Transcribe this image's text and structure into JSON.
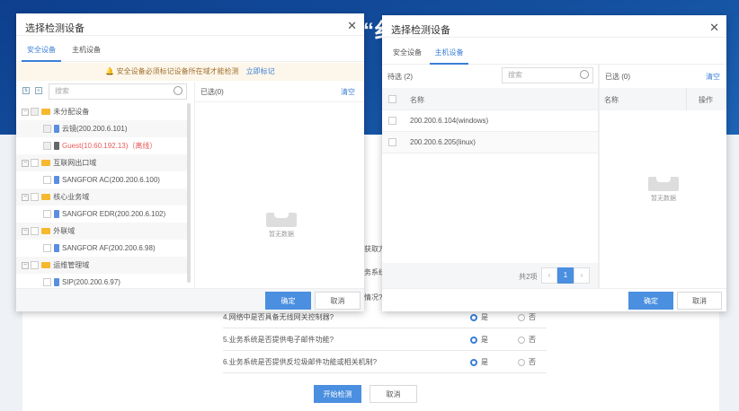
{
  "background": {
    "title_fragment": "“纟",
    "questions": [
      {
        "text": "4.网络中是否具备无线网关控制器?",
        "yes": "是",
        "no": "否",
        "selected": "yes"
      },
      {
        "text": "5.业务系统是否提供电子邮件功能?",
        "yes": "是",
        "no": "否",
        "selected": "yes"
      },
      {
        "text": "6.业务系统是否提供反垃圾邮件功能或相关机制?",
        "yes": "是",
        "no": "否",
        "selected": "yes"
      }
    ],
    "partial_texts": [
      "获取方",
      "务系统'",
      "情况?"
    ],
    "start_label": "开始检测",
    "cancel_label": "取消"
  },
  "left_dialog": {
    "title": "选择检测设备",
    "tabs": [
      "安全设备",
      "主机设备"
    ],
    "active_tab": 0,
    "warning": "安全设备必须标记设备所在域才能检测",
    "warning_link": "立即标记",
    "search_placeholder": "搜索",
    "selected_label": "已选(0)",
    "clear_label": "清空",
    "tree": [
      {
        "type": "group",
        "label": "未分配设备",
        "disabled": true
      },
      {
        "type": "device",
        "label": "云镜(200.200.6.101)",
        "disabled": true
      },
      {
        "type": "device",
        "label": "Guest(10.60.192.13)（离线）",
        "disabled": true,
        "offline": true
      },
      {
        "type": "group",
        "label": "互联网出口域"
      },
      {
        "type": "device",
        "label": "SANGFOR AC(200.200.6.100)"
      },
      {
        "type": "group",
        "label": "核心业务域"
      },
      {
        "type": "device",
        "label": "SANGFOR EDR(200.200.6.102)"
      },
      {
        "type": "group",
        "label": "外联域"
      },
      {
        "type": "device",
        "label": "SANGFOR AF(200.200.6.98)"
      },
      {
        "type": "group",
        "label": "运维管理域"
      },
      {
        "type": "device",
        "label": "SIP(200.200.6.97)"
      }
    ],
    "empty_text": "暂无数据",
    "ok_label": "确定",
    "cancel_label": "取消"
  },
  "right_dialog": {
    "title": "选择检测设备",
    "tabs": [
      "安全设备",
      "主机设备"
    ],
    "active_tab": 1,
    "pending_label": "待选 (2)",
    "search_placeholder": "搜索",
    "col_name": "名称",
    "rows": [
      "200.200.6.104(windows)",
      "200.200.6.205(linux)"
    ],
    "total": "共2项",
    "page": "1",
    "selected_label": "已选 (0)",
    "clear_label": "清空",
    "sel_col_name": "名称",
    "sel_col_action": "操作",
    "empty_text": "暂无数据",
    "ok_label": "确定",
    "cancel_label": "取消"
  },
  "colors": {
    "primary": "#4a8fe0",
    "offline": "#e85a5a",
    "folder": "#f5b82e"
  }
}
